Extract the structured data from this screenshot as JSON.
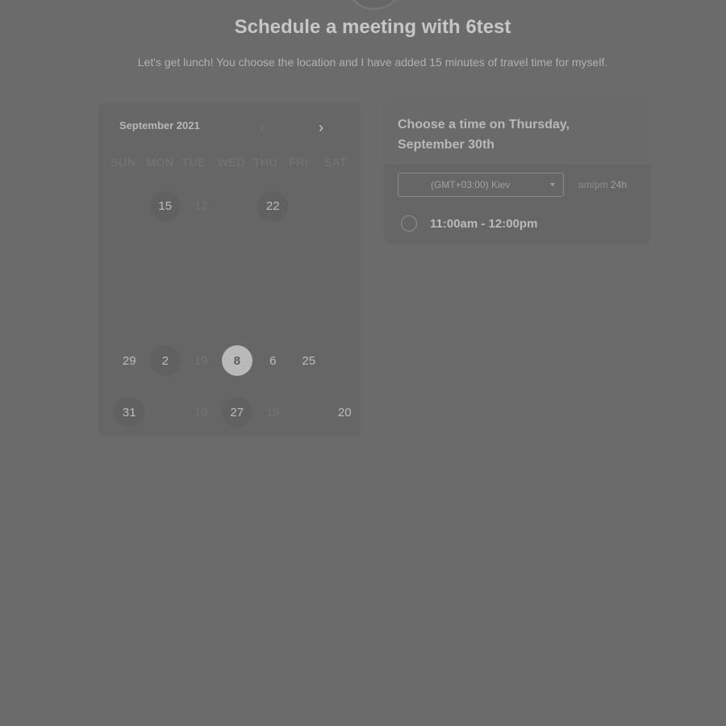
{
  "header": {
    "title": "Schedule a meeting with 6test",
    "description": "Let's get lunch! You choose the location and I have added 15 minutes of travel time for myself."
  },
  "calendar": {
    "month_label": "September 2021",
    "prev_icon": "chevron-left-icon",
    "next_icon": "chevron-right-icon",
    "weekdays": [
      "SUN",
      "MON",
      "TUE",
      "WED",
      "THU",
      "FRI",
      "SAT"
    ],
    "weeks": [
      [
        {
          "label": "",
          "state": "blank"
        },
        {
          "label": "15",
          "state": "available"
        },
        {
          "label": "12",
          "state": "unavailable"
        },
        {
          "label": "",
          "state": "blank"
        },
        {
          "label": "22",
          "state": "available"
        },
        {
          "label": "",
          "state": "blank"
        },
        {
          "label": "",
          "state": "blank"
        }
      ],
      [
        {
          "label": "",
          "state": "blank"
        },
        {
          "label": "",
          "state": "blank"
        },
        {
          "label": "",
          "state": "blank"
        },
        {
          "label": "",
          "state": "blank"
        },
        {
          "label": "",
          "state": "blank"
        },
        {
          "label": "",
          "state": "blank"
        },
        {
          "label": "",
          "state": "blank"
        }
      ],
      [
        {
          "label": "",
          "state": "blank"
        },
        {
          "label": "",
          "state": "blank"
        },
        {
          "label": "",
          "state": "blank"
        },
        {
          "label": "",
          "state": "blank"
        },
        {
          "label": "",
          "state": "blank"
        },
        {
          "label": "",
          "state": "blank"
        },
        {
          "label": "",
          "state": "blank"
        }
      ],
      [
        {
          "label": "29",
          "state": "bright"
        },
        {
          "label": "2",
          "state": "available"
        },
        {
          "label": "19",
          "state": "unavailable"
        },
        {
          "label": "8",
          "state": "selected"
        },
        {
          "label": "6",
          "state": "bright"
        },
        {
          "label": "25",
          "state": "bright"
        },
        {
          "label": "",
          "state": "blank"
        }
      ],
      [
        {
          "label": "31",
          "state": "available"
        },
        {
          "label": "",
          "state": "blank"
        },
        {
          "label": "19",
          "state": "unavailable"
        },
        {
          "label": "27",
          "state": "available"
        },
        {
          "label": "19",
          "state": "unavailable"
        },
        {
          "label": "",
          "state": "blank"
        },
        {
          "label": "20",
          "state": "bright"
        }
      ]
    ]
  },
  "slots": {
    "title": "Choose a time on Thursday, September 30th",
    "timezone_value": "(GMT+03:00) Kiev",
    "format_ampm": "am/pm",
    "format_24h": "24h",
    "times": [
      "11:00am - 12:00pm"
    ]
  }
}
